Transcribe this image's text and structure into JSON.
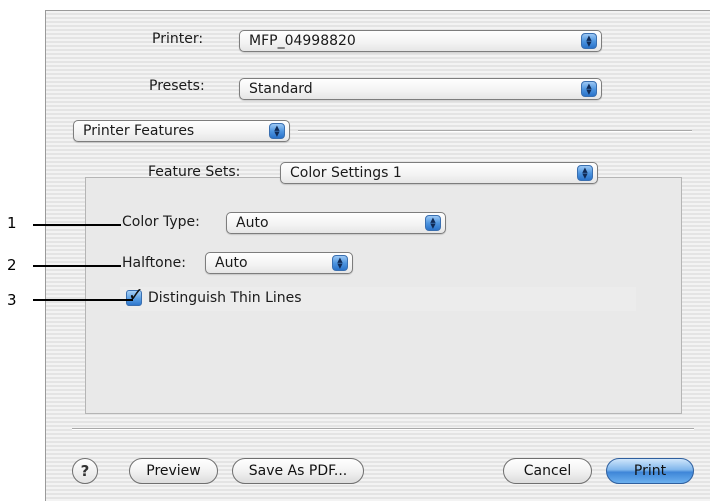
{
  "dialog": {
    "printer": {
      "label": "Printer:",
      "value": "MFP_04998820"
    },
    "presets": {
      "label": "Presets:",
      "value": "Standard"
    },
    "panel": {
      "value": "Printer Features"
    },
    "feature_sets": {
      "label": "Feature Sets:",
      "value": "Color Settings 1"
    },
    "color_type": {
      "label": "Color Type:",
      "value": "Auto"
    },
    "halftone": {
      "label": "Halftone:",
      "value": "Auto"
    },
    "thin_lines": {
      "label": "Distinguish Thin Lines",
      "checked": true
    },
    "buttons": {
      "help": "?",
      "preview": "Preview",
      "save_pdf": "Save As PDF...",
      "cancel": "Cancel",
      "print": "Print"
    }
  },
  "callouts": [
    "1",
    "2",
    "3"
  ],
  "icons": {
    "popup_arrows": "up-down-arrows-icon",
    "checkbox": "checkmark-icon",
    "help": "question-mark-icon"
  },
  "colors": {
    "accent_blue": "#4f96e0",
    "dialog_bg": "#ececec"
  }
}
